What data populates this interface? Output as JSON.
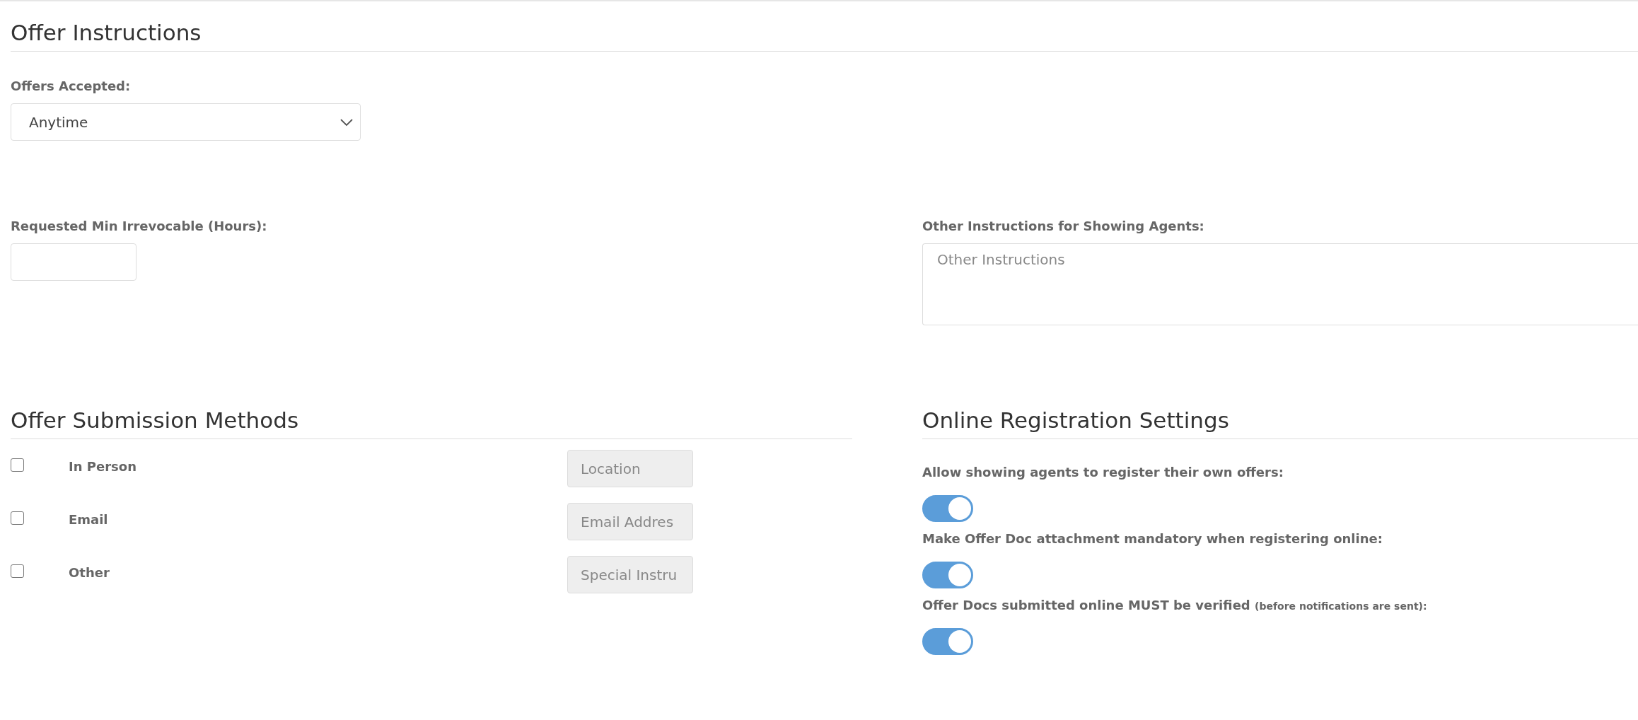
{
  "offer_instructions": {
    "title": "Offer Instructions",
    "offers_accepted": {
      "label": "Offers Accepted:",
      "value": "Anytime"
    },
    "min_irrevocable": {
      "label": "Requested Min Irrevocable (Hours):"
    },
    "other_instructions": {
      "label": "Other Instructions for Showing Agents:",
      "placeholder": "Other Instructions"
    }
  },
  "submission_methods": {
    "title": "Offer Submission Methods",
    "methods": [
      {
        "label": "In Person",
        "checked": false,
        "placeholder": "Location"
      },
      {
        "label": "Email",
        "checked": false,
        "placeholder": "Email Addres"
      },
      {
        "label": "Other",
        "checked": false,
        "placeholder": "Special Instru"
      }
    ]
  },
  "online_registration": {
    "title": "Online Registration Settings",
    "settings": [
      {
        "label": "Allow showing agents to register their own offers:",
        "on": true
      },
      {
        "label": "Make Offer Doc attachment mandatory when registering online:",
        "on": true
      },
      {
        "label": "Offer Docs submitted online MUST be verified",
        "note": "(before notifications are sent):",
        "on": true
      }
    ]
  }
}
